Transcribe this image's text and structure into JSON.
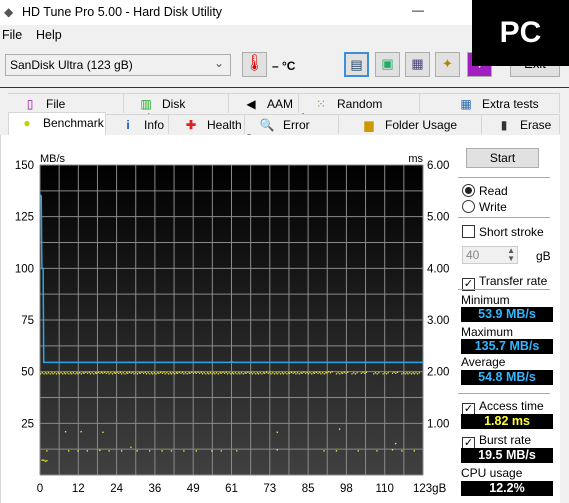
{
  "window": {
    "title": "HD Tune Pro 5.00 - Hard Disk Utility",
    "minimize": "—"
  },
  "menu": [
    "File",
    "Help"
  ],
  "toolbar": {
    "drive": "SanDisk Ultra (123 gB)",
    "temperature": "– °C",
    "exit": "Exit"
  },
  "logo": "PC",
  "tabs_top": [
    {
      "label": "File Benchmark",
      "icon": "file-benchmark-icon"
    },
    {
      "label": "Disk monitor",
      "icon": "disk-monitor-icon"
    },
    {
      "label": "AAM",
      "icon": "speaker-icon"
    },
    {
      "label": "Random Access",
      "icon": "random-access-icon"
    },
    {
      "label": "Extra tests",
      "icon": "extra-tests-icon"
    }
  ],
  "tabs_bottom": [
    {
      "label": "Benchmark",
      "icon": "bulb-icon"
    },
    {
      "label": "Info",
      "icon": "info-icon"
    },
    {
      "label": "Health",
      "icon": "health-cross-icon"
    },
    {
      "label": "Error Scan",
      "icon": "magnifier-icon"
    },
    {
      "label": "Folder Usage",
      "icon": "folder-icon"
    },
    {
      "label": "Erase",
      "icon": "trash-icon"
    }
  ],
  "side": {
    "start": "Start",
    "read": "Read",
    "write": "Write",
    "short_stroke": "Short stroke",
    "stroke_value": "40",
    "stroke_unit": "gB",
    "transfer_rate": "Transfer rate",
    "minimum_label": "Minimum",
    "minimum": "53.9 MB/s",
    "maximum_label": "Maximum",
    "maximum": "135.7 MB/s",
    "average_label": "Average",
    "average": "54.8 MB/s",
    "access_time": "Access time",
    "access_value": "1.82 ms",
    "burst_rate": "Burst rate",
    "burst_value": "19.5 MB/s",
    "cpu_label": "CPU usage",
    "cpu_value": "12.2%"
  },
  "colors": {
    "transfer": "#2aa7e8",
    "access": "#ffff33",
    "access_value": "#ffff33",
    "value_text": "#33b5ff"
  },
  "chart_data": {
    "type": "line",
    "ylabel": "MB/s",
    "y2label": "ms",
    "xunit": "gB",
    "xlim": [
      0,
      123
    ],
    "ylim": [
      0,
      150
    ],
    "y2lim": [
      0,
      6
    ],
    "xticks": [
      "0",
      "12",
      "24",
      "36",
      "49",
      "61",
      "73",
      "85",
      "98",
      "110",
      "123gB"
    ],
    "yticks": [
      "150",
      "125",
      "100",
      "75",
      "50",
      "25"
    ],
    "y2ticks": [
      "6.00",
      "5.00",
      "4.00",
      "3.00",
      "2.00",
      "1.00"
    ],
    "grid": true,
    "series": [
      {
        "name": "Transfer rate",
        "axis": "left",
        "x": [
          0,
          0.4,
          0.6,
          1.0,
          1.2,
          61,
          61.5,
          62,
          123
        ],
        "y": [
          135.7,
          135,
          100,
          100,
          54.5,
          54.5,
          55,
          54.5,
          54.5
        ]
      },
      {
        "name": "Access time",
        "axis": "right",
        "type": "scatter",
        "x": [
          0,
          2,
          4,
          6,
          8,
          10,
          12,
          14,
          16,
          18,
          20,
          22,
          24,
          26,
          28,
          30,
          32,
          34,
          36,
          38,
          40,
          42,
          44,
          46,
          48,
          50,
          52,
          54,
          56,
          58,
          60,
          62,
          64,
          66,
          68,
          70,
          72,
          74,
          76,
          78,
          80,
          82,
          84,
          86,
          88,
          90,
          92,
          95,
          97,
          100,
          103,
          107,
          110,
          113,
          116,
          118,
          120,
          0.5,
          1,
          1.5,
          2,
          8,
          13,
          20,
          76,
          96,
          2,
          9,
          12,
          15,
          19,
          22,
          26,
          29,
          31,
          35,
          39,
          42,
          46,
          50,
          55,
          58,
          63,
          76,
          91,
          95,
          102,
          108,
          113,
          116,
          120,
          114
        ],
        "y": [
          1.97,
          1.97,
          1.97,
          1.97,
          1.97,
          1.97,
          1.97,
          1.98,
          1.97,
          1.98,
          1.98,
          1.97,
          1.98,
          1.97,
          1.98,
          1.97,
          1.98,
          1.97,
          1.97,
          1.98,
          1.97,
          1.97,
          1.98,
          1.97,
          1.98,
          1.98,
          1.97,
          1.97,
          1.97,
          1.98,
          1.97,
          1.97,
          1.97,
          1.98,
          1.97,
          1.97,
          1.98,
          1.97,
          1.97,
          1.97,
          1.98,
          1.97,
          1.98,
          1.97,
          1.98,
          1.97,
          1.99,
          1.97,
          1.98,
          1.97,
          1.98,
          1.97,
          1.97,
          1.98,
          1.97,
          1.97,
          1.97,
          0.3,
          0.3,
          0.28,
          0.29,
          0.85,
          0.85,
          0.84,
          0.84,
          0.9,
          0.48,
          0.48,
          0.48,
          0.48,
          0.49,
          0.48,
          0.48,
          0.55,
          0.48,
          0.48,
          0.48,
          0.48,
          0.48,
          0.48,
          0.48,
          0.48,
          0.48,
          0.5,
          0.48,
          0.48,
          0.48,
          0.48,
          0.5,
          0.48,
          0.48,
          0.62
        ]
      }
    ]
  }
}
